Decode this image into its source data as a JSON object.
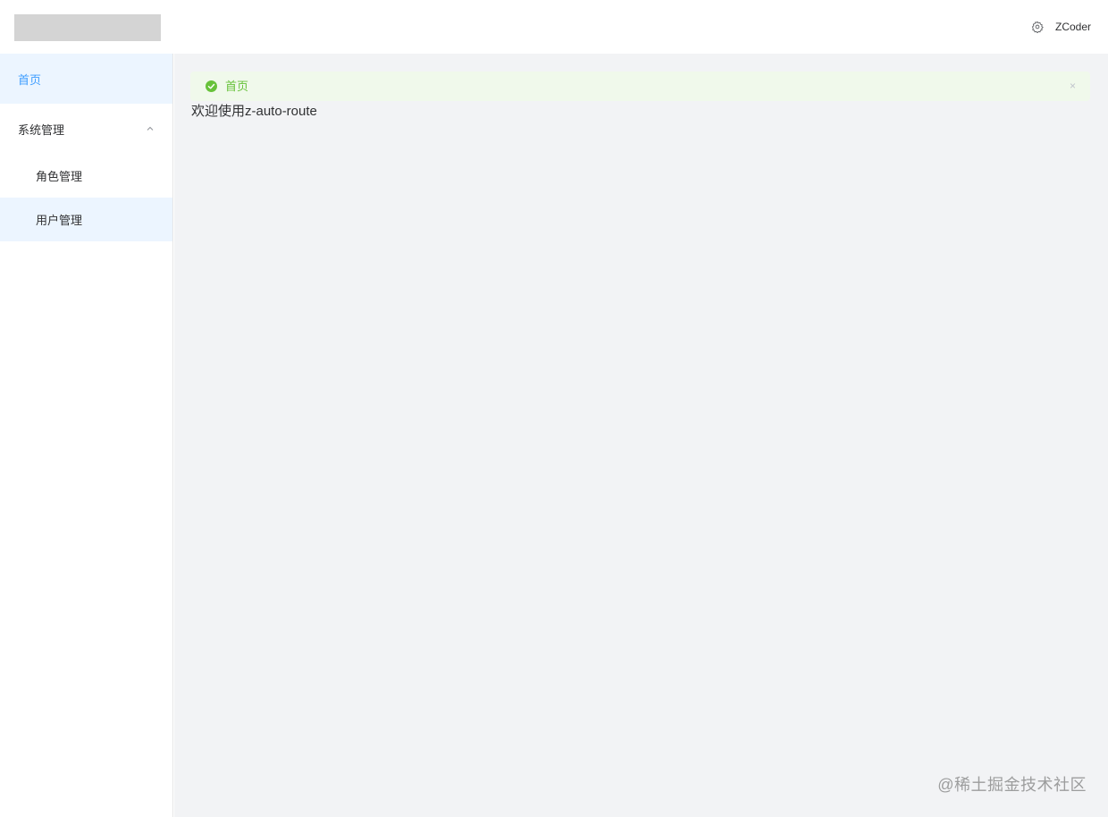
{
  "header": {
    "settings_icon": "gear-icon",
    "username": "ZCoder"
  },
  "sidebar": {
    "items": [
      {
        "label": "首页",
        "active": true
      },
      {
        "label": "系统管理",
        "expanded": true,
        "icon": "chevron-up-icon",
        "children": [
          {
            "label": "角色管理"
          },
          {
            "label": "用户管理",
            "selected": true
          }
        ]
      }
    ]
  },
  "main": {
    "alert": {
      "type": "success",
      "icon": "check-circle-icon",
      "title": "首页",
      "close_label": "×"
    },
    "welcome_text": "欢迎使用z-auto-route"
  },
  "watermark": "@稀土掘金技术社区",
  "colors": {
    "accent": "#409eff",
    "success": "#67c23a",
    "active_bg": "#ecf5ff",
    "main_bg": "#f2f3f5"
  }
}
